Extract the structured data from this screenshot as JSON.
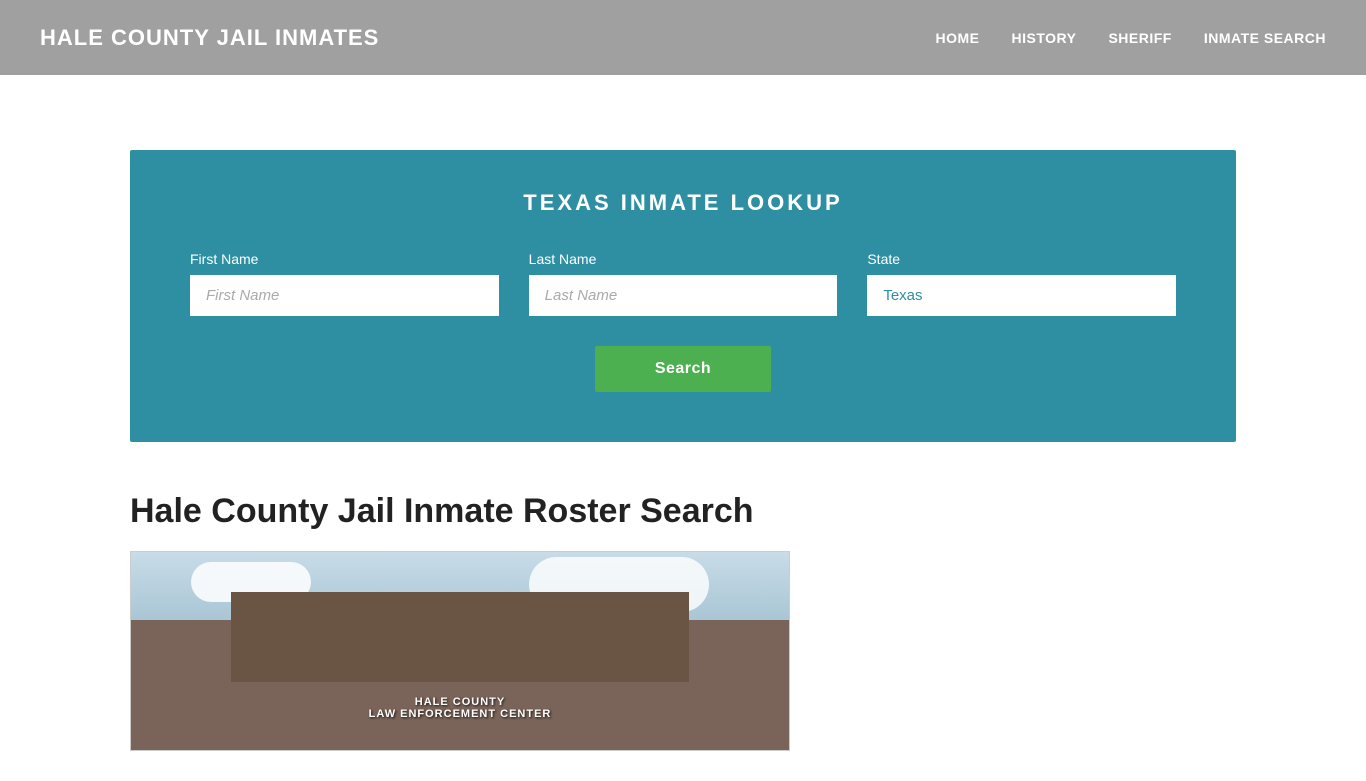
{
  "header": {
    "site_title": "HALE COUNTY JAIL INMATES",
    "nav": {
      "home": "HOME",
      "history": "HISTORY",
      "sheriff": "SHERIFF",
      "inmate_search": "INMATE SEARCH"
    }
  },
  "search_section": {
    "title": "TEXAS INMATE LOOKUP",
    "first_name_label": "First Name",
    "first_name_placeholder": "First Name",
    "last_name_label": "Last Name",
    "last_name_placeholder": "Last Name",
    "state_label": "State",
    "state_value": "Texas",
    "search_button": "Search"
  },
  "content": {
    "heading": "Hale County Jail Inmate Roster Search",
    "building_line1": "HALE COUNTY",
    "building_line2": "LAW ENFORCEMENT CENTER"
  },
  "colors": {
    "header_bg": "#a0a0a0",
    "search_bg": "#2e8fa3",
    "search_btn": "#4caf50",
    "nav_text": "#ffffff",
    "title_text": "#ffffff"
  }
}
